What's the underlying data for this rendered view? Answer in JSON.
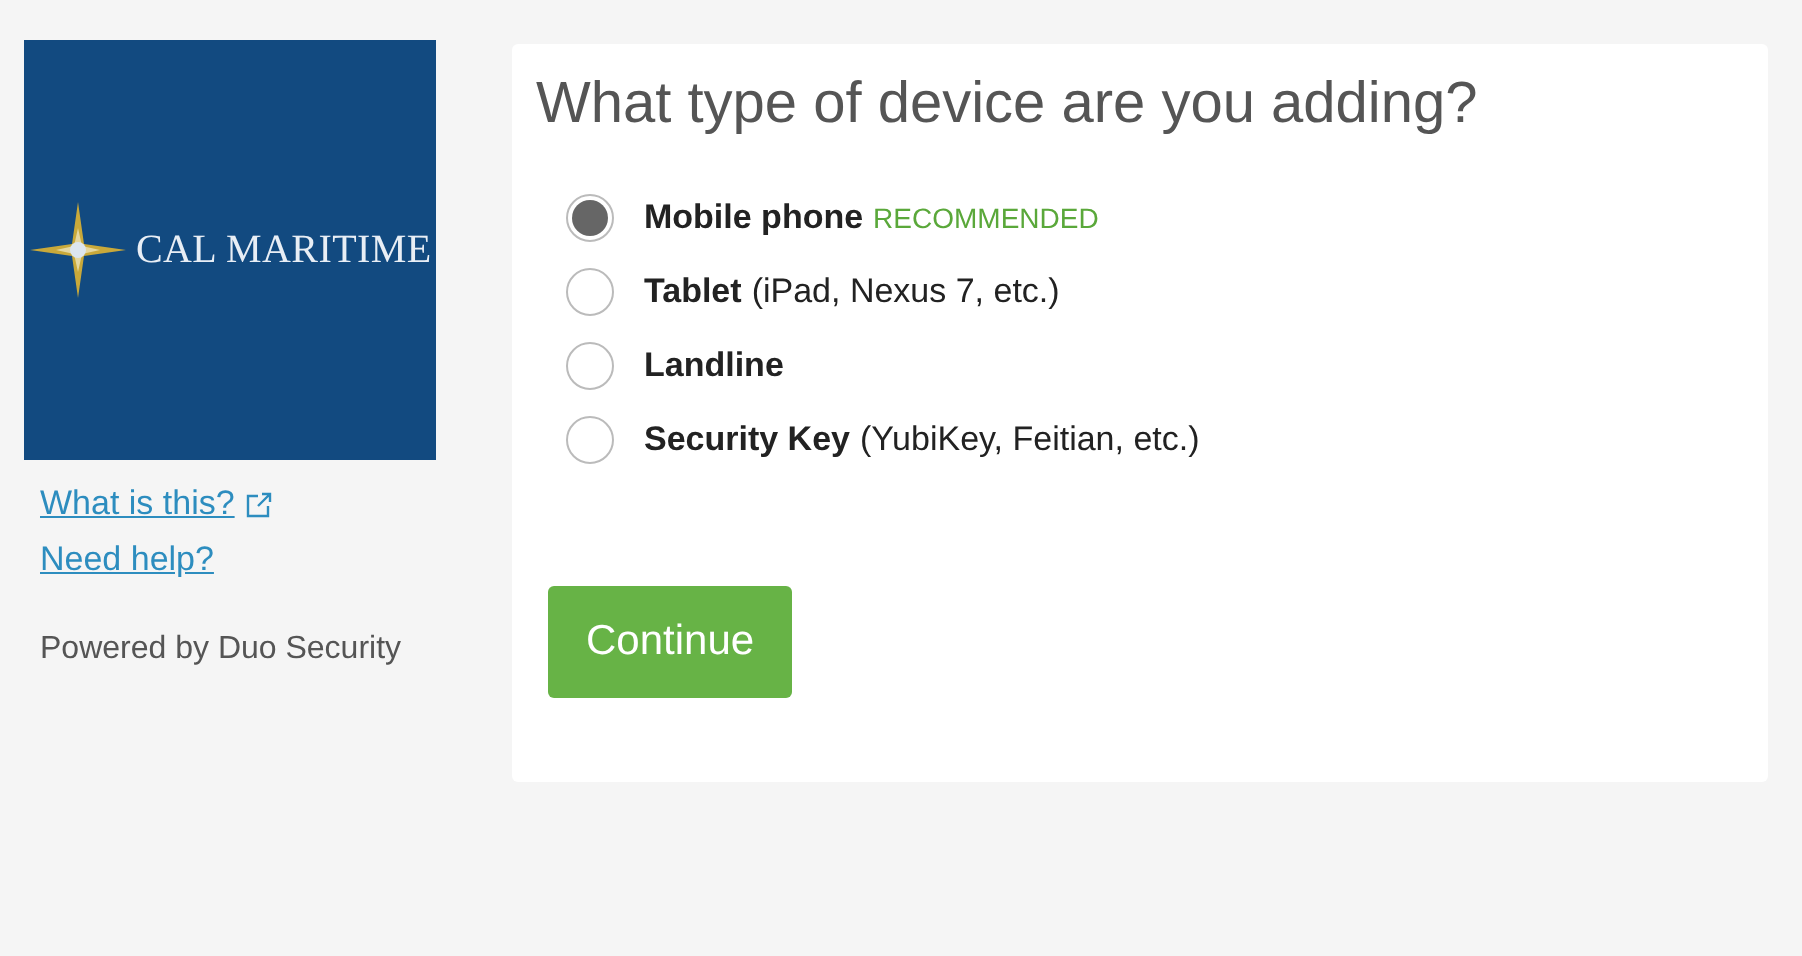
{
  "sidebar": {
    "logo_text": "CAL MARITIME",
    "links": [
      {
        "label": "What is this?",
        "external": true
      },
      {
        "label": "Need help?",
        "external": false
      }
    ],
    "powered_by": "Powered by Duo Security"
  },
  "card": {
    "title": "What type of device are you adding?",
    "options": [
      {
        "name": "Mobile phone",
        "badge": "RECOMMENDED",
        "selected": true
      },
      {
        "name": "Tablet",
        "detail": "(iPad, Nexus 7, etc.)",
        "selected": false
      },
      {
        "name": "Landline",
        "selected": false
      },
      {
        "name": "Security Key",
        "detail": "(YubiKey, Feitian, etc.)",
        "selected": false
      }
    ],
    "button": "Continue"
  }
}
